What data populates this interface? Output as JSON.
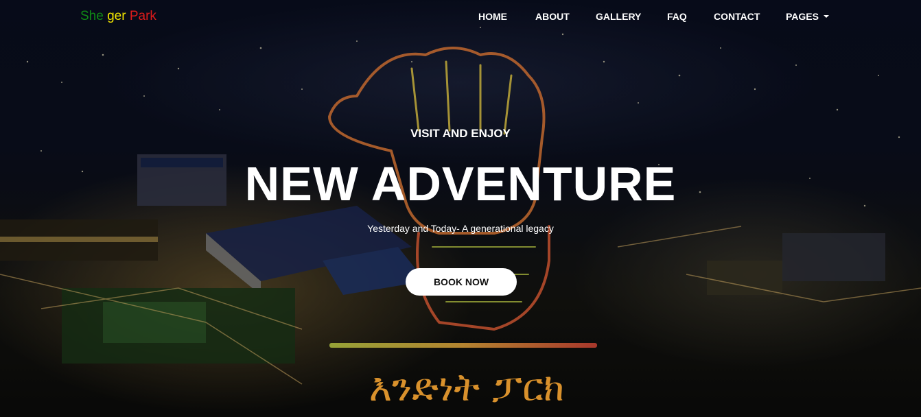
{
  "brand": {
    "part1": "She",
    "part2": " ger",
    "part3": " Park",
    "colors": [
      "#0f8a16",
      "#f2e600",
      "#e01b1b"
    ]
  },
  "nav": {
    "items": [
      {
        "label": "HOME"
      },
      {
        "label": "ABOUT"
      },
      {
        "label": "GALLERY"
      },
      {
        "label": "FAQ"
      },
      {
        "label": "CONTACT"
      },
      {
        "label": "PAGES"
      }
    ]
  },
  "hero": {
    "kicker": "VISIT AND ENJOY",
    "headline": "NEW ADVENTURE",
    "tagline": "Yesterday and Today- A generational legacy",
    "cta_label": "BOOK NOW",
    "background_image": "night aerial view of the park with illuminated neon fist sculpture and Amharic sign"
  },
  "sign": {
    "text": "እንድነት ፓርክ"
  }
}
